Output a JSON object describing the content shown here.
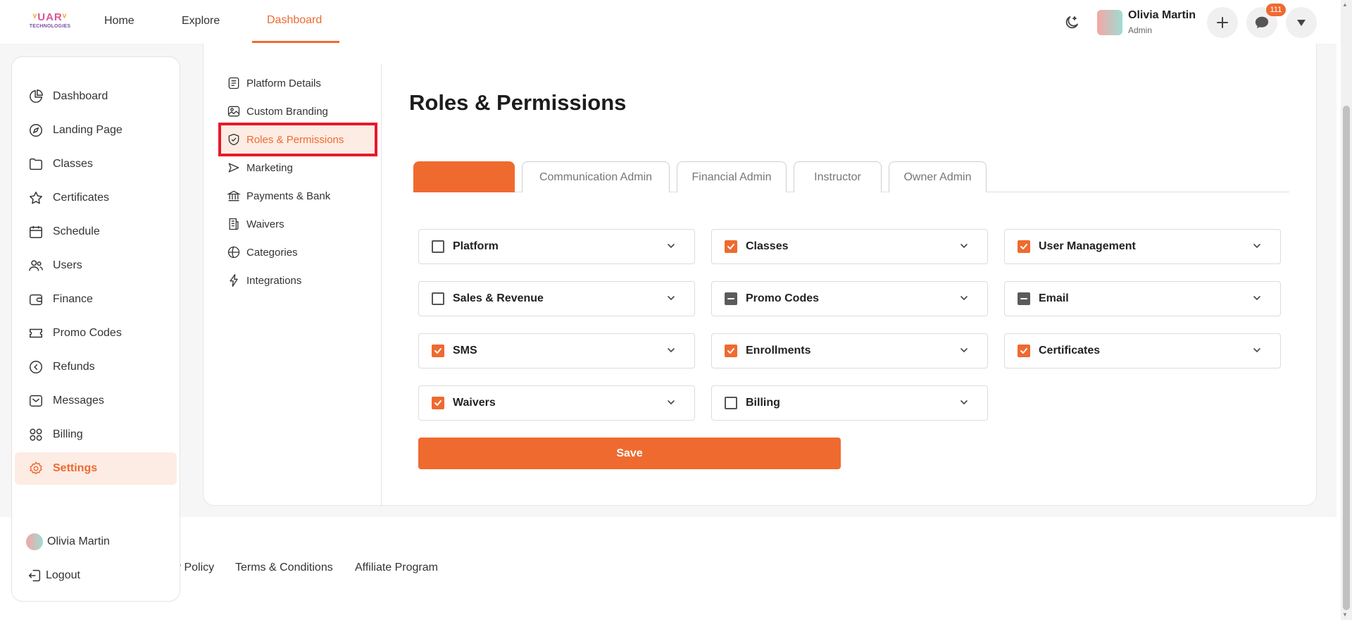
{
  "brand": {
    "name": "UAR",
    "sub": "TECHNOLOGIES"
  },
  "topnav": {
    "home": "Home",
    "explore": "Explore",
    "dashboard": "Dashboard"
  },
  "user": {
    "name": "Olivia Martin",
    "role": "Admin",
    "notification_count": "111"
  },
  "sidebar": {
    "items": [
      {
        "label": "Dashboard",
        "icon": "pie-chart-icon"
      },
      {
        "label": "Landing Page",
        "icon": "compass-icon"
      },
      {
        "label": "Classes",
        "icon": "folder-icon"
      },
      {
        "label": "Certificates",
        "icon": "star-icon"
      },
      {
        "label": "Schedule",
        "icon": "calendar-icon"
      },
      {
        "label": "Users",
        "icon": "users-icon"
      },
      {
        "label": "Finance",
        "icon": "wallet-icon"
      },
      {
        "label": "Promo Codes",
        "icon": "ticket-icon"
      },
      {
        "label": "Refunds",
        "icon": "refund-icon"
      },
      {
        "label": "Messages",
        "icon": "mail-icon"
      },
      {
        "label": "Billing",
        "icon": "grid-icon"
      },
      {
        "label": "Settings",
        "icon": "gear-icon",
        "active": true
      }
    ],
    "user_name": "Olivia Martin",
    "logout": "Logout"
  },
  "settings_menu": [
    {
      "label": "Platform Details",
      "icon": "document-icon"
    },
    {
      "label": "Custom Branding",
      "icon": "image-icon"
    },
    {
      "label": "Roles & Permissions",
      "icon": "shield-check-icon",
      "active": true
    },
    {
      "label": "Marketing",
      "icon": "megaphone-icon"
    },
    {
      "label": "Payments & Bank",
      "icon": "bank-icon"
    },
    {
      "label": "Waivers",
      "icon": "receipt-icon"
    },
    {
      "label": "Categories",
      "icon": "globe-icon"
    },
    {
      "label": "Integrations",
      "icon": "bolt-icon"
    }
  ],
  "page_title": "Roles & Permissions",
  "tabs": [
    {
      "label": "",
      "active": true
    },
    {
      "label": "Communication Admin"
    },
    {
      "label": "Financial Admin"
    },
    {
      "label": "Instructor"
    },
    {
      "label": "Owner Admin"
    }
  ],
  "permissions": [
    {
      "label": "Platform",
      "state": "unchecked"
    },
    {
      "label": "Classes",
      "state": "checked"
    },
    {
      "label": "User Management",
      "state": "checked"
    },
    {
      "label": "Sales & Revenue",
      "state": "unchecked"
    },
    {
      "label": "Promo Codes",
      "state": "indeterminate"
    },
    {
      "label": "Email",
      "state": "indeterminate"
    },
    {
      "label": "SMS",
      "state": "checked"
    },
    {
      "label": "Enrollments",
      "state": "checked"
    },
    {
      "label": "Certificates",
      "state": "checked"
    },
    {
      "label": "Waivers",
      "state": "checked"
    },
    {
      "label": "Billing",
      "state": "unchecked"
    }
  ],
  "save_label": "Save",
  "footer": {
    "privacy": "y Policy",
    "terms": "Terms & Conditions",
    "affiliate": "Affiliate Program"
  },
  "colors": {
    "accent": "#ef6a2f",
    "active_bg": "#fdece3",
    "highlight_border": "#e8192c"
  }
}
